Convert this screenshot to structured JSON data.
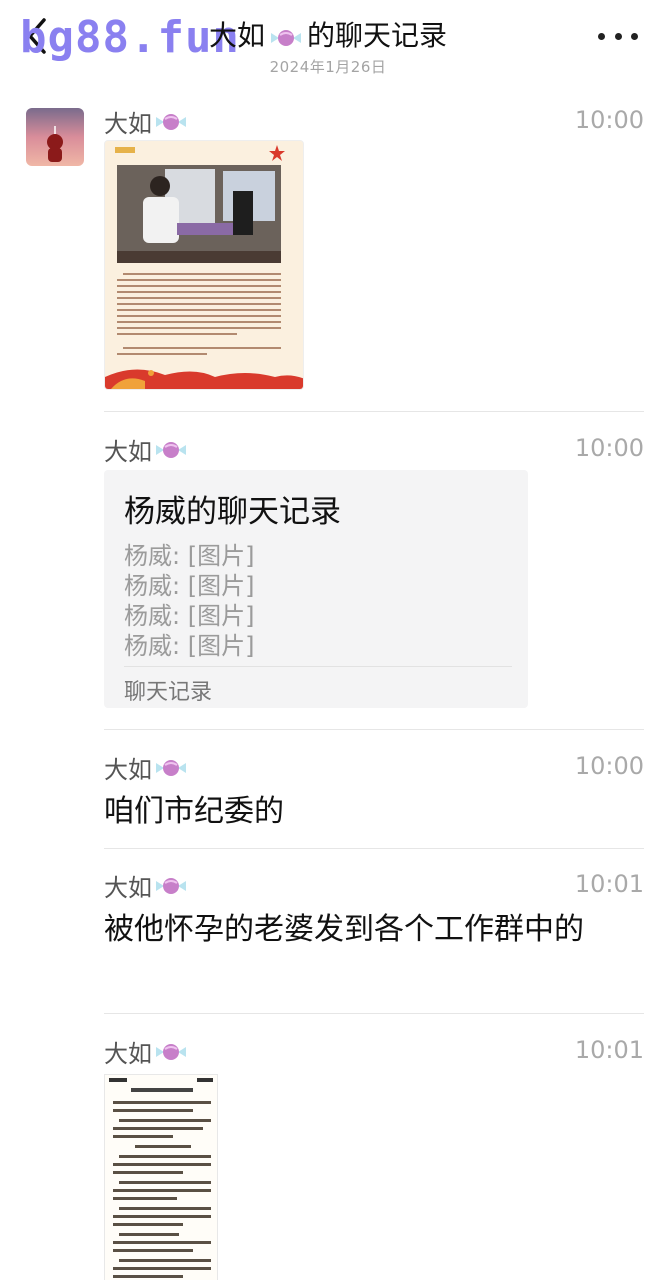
{
  "header": {
    "watermark": "bg88.fun",
    "title_prefix": "大如",
    "title_suffix": "的聊天记录",
    "subtitle": "2024年1月26日"
  },
  "messages": [
    {
      "sender": "大如",
      "time": "10:00",
      "type": "image"
    },
    {
      "sender": "大如",
      "time": "10:00",
      "type": "chat_record",
      "record": {
        "title": "杨威的聊天记录",
        "lines": [
          "杨威: [图片]",
          "杨威: [图片]",
          "杨威: [图片]",
          "杨威: [图片]"
        ],
        "footer": "聊天记录"
      }
    },
    {
      "sender": "大如",
      "time": "10:00",
      "type": "text",
      "text": "咱们市纪委的"
    },
    {
      "sender": "大如",
      "time": "10:01",
      "type": "text",
      "text": "被他怀孕的老婆发到各个工作群中的"
    },
    {
      "sender": "大如",
      "time": "10:01",
      "type": "image"
    }
  ],
  "colors": {
    "watermark": "#8a80f0",
    "record_bg": "#f4f4f5",
    "time": "#a9a9a9"
  },
  "icons": [
    "back-chevron-icon",
    "candy-emoji-icon",
    "more-dots-icon"
  ]
}
